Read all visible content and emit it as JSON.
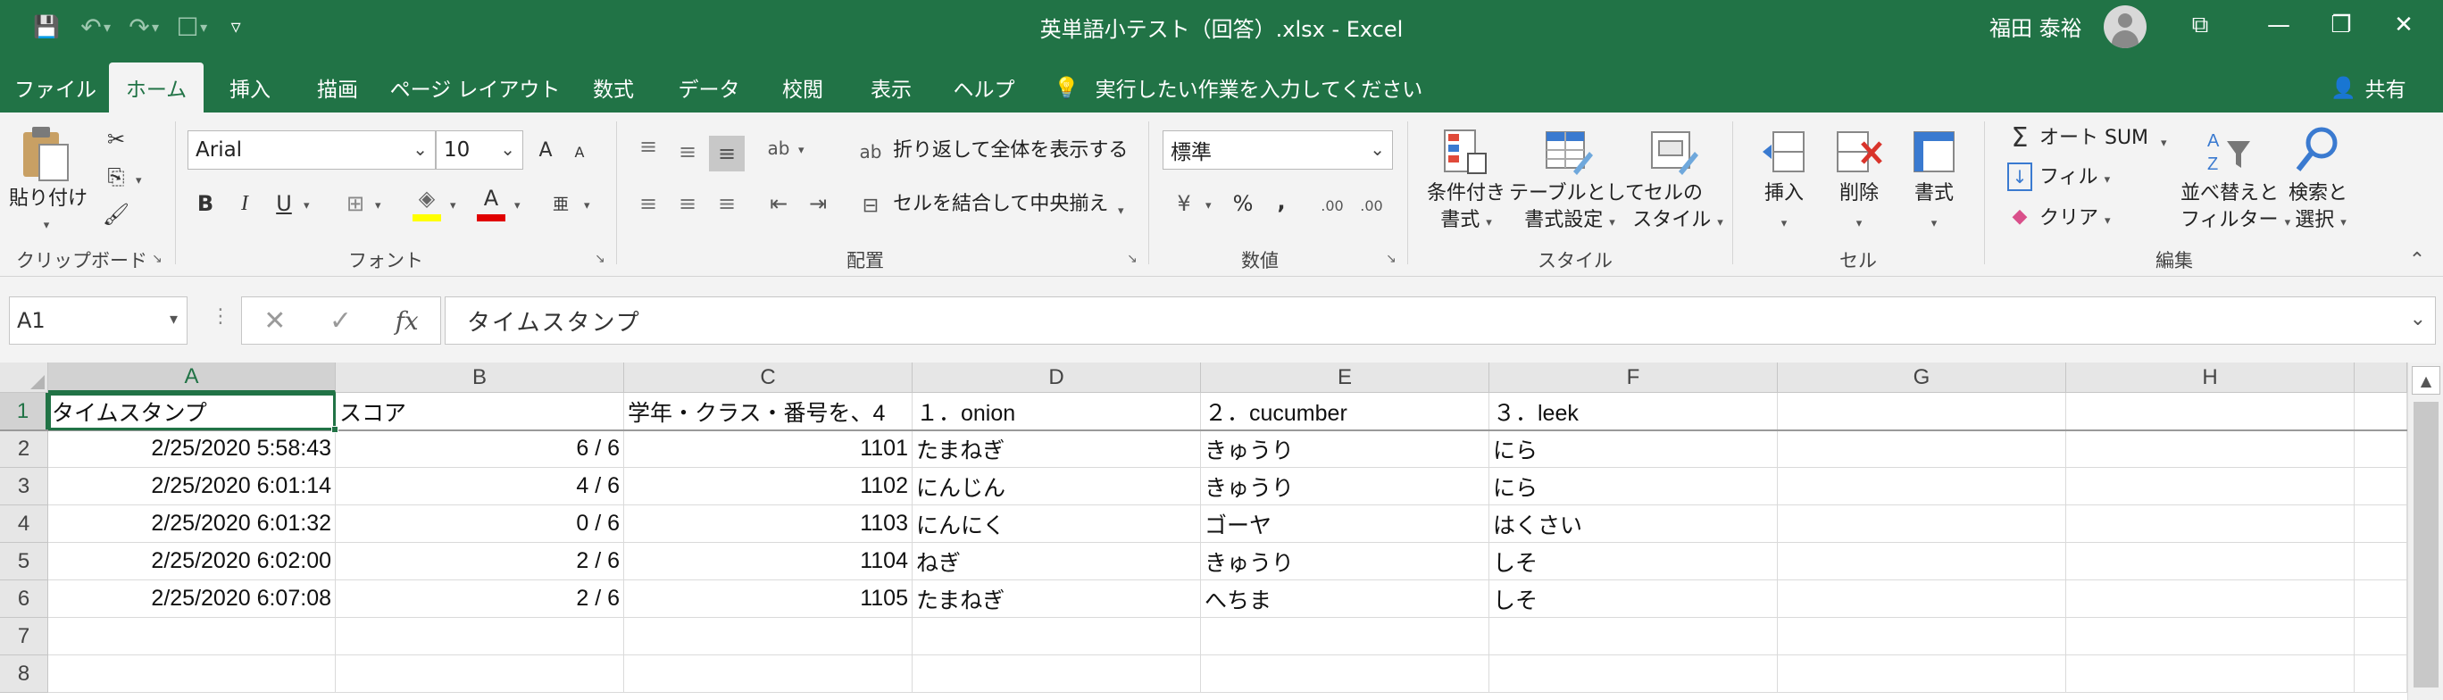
{
  "window": {
    "title": "英単語小テスト（回答）.xlsx  -  Excel",
    "user_name": "福田 泰裕",
    "minimize": "—",
    "restore": "❐",
    "close": "✕",
    "ribbon_display": "⧉"
  },
  "qat": {
    "save": "💾",
    "undo": "↶",
    "redo": "↷",
    "touch": "☐",
    "customize": "▿",
    "dd": "▾"
  },
  "tabs": [
    "ファイル",
    "ホーム",
    "挿入",
    "描画",
    "ページ レイアウト",
    "数式",
    "データ",
    "校閲",
    "表示",
    "ヘルプ"
  ],
  "active_tab": "ホーム",
  "tell_me": {
    "icon": "💡",
    "text": "実行したい作業を入力してください"
  },
  "share": {
    "icon": "👤",
    "label": "共有"
  },
  "ribbon": {
    "clipboard": {
      "group": "クリップボード",
      "paste": "貼り付け",
      "cut": "✂",
      "copy": "⎘",
      "format_painter": "🖌"
    },
    "font": {
      "group": "フォント",
      "name": "Arial",
      "size": "10",
      "grow": "A",
      "shrink": "A",
      "bold": "B",
      "italic": "I",
      "underline": "U",
      "border": "⊞",
      "fill": "◈",
      "color": "A",
      "phonetic": "亜"
    },
    "alignment": {
      "group": "配置",
      "wrap": "折り返して全体を表示する",
      "merge": "セルを結合して中央揃え",
      "top": "≡",
      "middle": "≡",
      "bottom": "≡",
      "left": "≡",
      "center": "≡",
      "right": "≡",
      "orientation": "ab",
      "indent_dec": "⇤",
      "indent_inc": "⇥"
    },
    "number": {
      "group": "数値",
      "format": "標準",
      "currency": "¥",
      "percent": "%",
      "comma": ",",
      "inc_dec": ".00",
      "dec_dec": ".00"
    },
    "styles": {
      "group": "スタイル",
      "conditional_l1": "条件付き",
      "conditional_l2": "書式",
      "table_l1": "テーブルとして",
      "table_l2": "書式設定",
      "cell_l1": "セルの",
      "cell_l2": "スタイル"
    },
    "cells": {
      "group": "セル",
      "insert": "挿入",
      "delete": "削除",
      "format": "書式"
    },
    "editing": {
      "group": "編集",
      "autosum": "オート SUM",
      "fill": "フィル",
      "clear": "クリア",
      "sort_l1": "並べ替えと",
      "sort_l2": "フィルター",
      "find_l1": "検索と",
      "find_l2": "選択",
      "collapse": "⌃"
    }
  },
  "formula_bar": {
    "name_box": "A1",
    "cancel": "✕",
    "enter": "✓",
    "fx": "fx",
    "content": "タイムスタンプ"
  },
  "sheet": {
    "columns": [
      "A",
      "B",
      "C",
      "D",
      "E",
      "F",
      "G",
      "H"
    ],
    "rows": [
      [
        "タイムスタンプ",
        "スコア",
        "学年・クラス・番号を、4",
        "１．onion",
        "２．cucumber",
        "３．leek",
        "",
        ""
      ],
      [
        "2/25/2020 5:58:43",
        "6 / 6",
        "1101",
        "たまねぎ",
        "きゅうり",
        "にら",
        "",
        ""
      ],
      [
        "2/25/2020 6:01:14",
        "4 / 6",
        "1102",
        "にんじん",
        "きゅうり",
        "にら",
        "",
        ""
      ],
      [
        "2/25/2020 6:01:32",
        "0 / 6",
        "1103",
        "にんにく",
        "ゴーヤ",
        "はくさい",
        "",
        ""
      ],
      [
        "2/25/2020 6:02:00",
        "2 / 6",
        "1104",
        "ねぎ",
        "きゅうり",
        "しそ",
        "",
        ""
      ],
      [
        "2/25/2020 6:07:08",
        "2 / 6",
        "1105",
        "たまねぎ",
        "へちま",
        "しそ",
        "",
        ""
      ],
      [
        "",
        "",
        "",
        "",
        "",
        "",
        "",
        ""
      ],
      [
        "",
        "",
        "",
        "",
        "",
        "",
        "",
        ""
      ]
    ],
    "row_numbers": [
      "1",
      "2",
      "3",
      "4",
      "5",
      "6",
      "7",
      "8"
    ]
  },
  "colors": {
    "excel_green": "#217346",
    "ribbon_bg": "#f3f3f3"
  }
}
